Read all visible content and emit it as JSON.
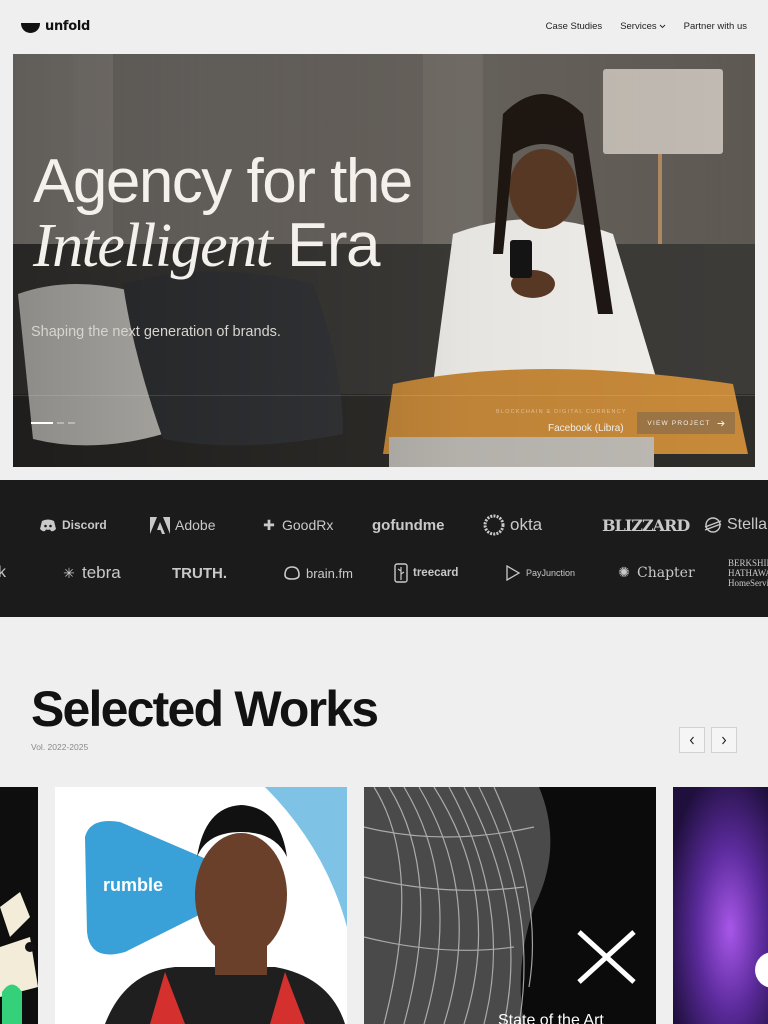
{
  "brand": {
    "name": "unfold"
  },
  "nav": {
    "items": [
      {
        "label": "Case Studies",
        "has_dropdown": false
      },
      {
        "label": "Services",
        "has_dropdown": true
      },
      {
        "label": "Partner with us",
        "has_dropdown": false
      }
    ]
  },
  "hero": {
    "title_line1": "Agency for the",
    "title_line2_italic": "Intelligent",
    "title_line2_rest": " Era",
    "subtitle": "Shaping the next generation of brands.",
    "project_category": "BLOCKCHAIN & DIGITAL CURRENCY",
    "project_name": "Facebook (Libra)",
    "view_button": "VIEW PROJECT",
    "slides": 3,
    "active_slide": 1
  },
  "clients": {
    "row1": [
      "Discord",
      "Adobe",
      "GoodRx",
      "gofundme",
      "okta",
      "BLIZZARD",
      "Stella"
    ],
    "row2": [
      "ck",
      "tebra",
      "TRUTH.",
      "brain.fm",
      "treecard",
      "PayJunction",
      "Chapter",
      "BERKSHIRE HATHAWAY HomeServices"
    ]
  },
  "works": {
    "title": "Selected Works",
    "volume": "Vol. 2022-2025",
    "prev_icon": "chevron-left-icon",
    "next_icon": "chevron-right-icon",
    "cards": [
      {
        "label": ""
      },
      {
        "label": "rumble"
      },
      {
        "label": "State of the Art"
      },
      {
        "label": ""
      }
    ]
  },
  "colors": {
    "page_bg": "#efefef",
    "logo_band_bg": "#1b1b1b",
    "hero_text": "#f4f1ec",
    "accent_blue": "#3aa0d8"
  }
}
